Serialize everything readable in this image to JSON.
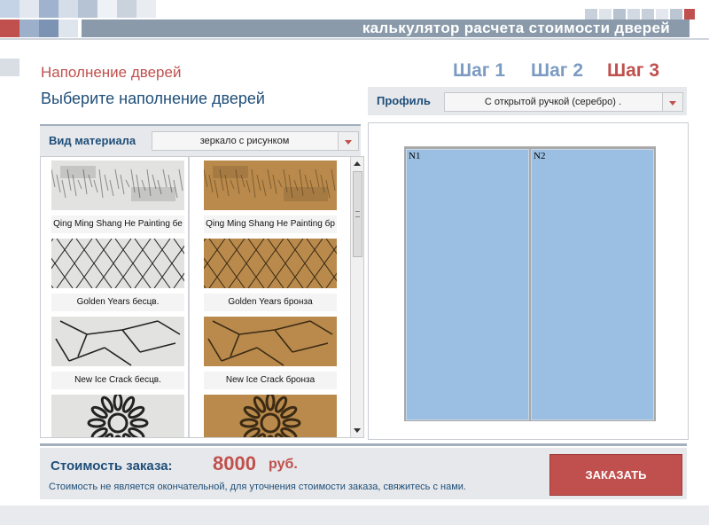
{
  "header": {
    "title": "калькулятор расчета стоимости дверей"
  },
  "section": {
    "title": "Наполнение дверей",
    "subtitle": "Выберите наполнение дверей"
  },
  "steps": [
    {
      "label": "Шаг 1",
      "active": false
    },
    {
      "label": "Шаг 2",
      "active": false
    },
    {
      "label": "Шаг 3",
      "active": true
    }
  ],
  "profile": {
    "label": "Профиль",
    "value": "С открытой ручкой (серебро)           ."
  },
  "material": {
    "label": "Вид материала",
    "value": "зеркало с рисунком"
  },
  "gallery": {
    "items": [
      {
        "caption": "Qing Ming Shang He Painting бе",
        "pattern": "painting",
        "tone": "silver"
      },
      {
        "caption": "Qing Ming Shang He Painting бр",
        "pattern": "painting",
        "tone": "bronze"
      },
      {
        "caption": "Golden Years бесцв.",
        "pattern": "lines",
        "tone": "silver"
      },
      {
        "caption": "Golden Years бронза",
        "pattern": "lines",
        "tone": "bronze"
      },
      {
        "caption": "New Ice Crack бесцв.",
        "pattern": "crack",
        "tone": "silver"
      },
      {
        "caption": "New Ice Crack бронза",
        "pattern": "crack",
        "tone": "bronze"
      },
      {
        "caption": "",
        "pattern": "flower",
        "tone": "silver"
      },
      {
        "caption": "",
        "pattern": "flower",
        "tone": "bronze"
      }
    ]
  },
  "preview": {
    "doors": [
      {
        "label": "N1"
      },
      {
        "label": "N2"
      }
    ]
  },
  "order": {
    "cost_label": "Стоимость заказа:",
    "cost_value": "8000",
    "cost_unit": "руб.",
    "note": "Стоимость не является окончательной, для уточнения стоимости заказа, свяжитесь с нами.",
    "button_label": "ЗАКАЗАТЬ"
  },
  "colors": {
    "accent_red": "#c0504d",
    "navy": "#1f4e79",
    "step_inactive": "#7b9bc1",
    "door_fill": "#9bbfe3",
    "silver_bg": "#e2e2e0",
    "bronze_bg": "#b98a4c"
  }
}
